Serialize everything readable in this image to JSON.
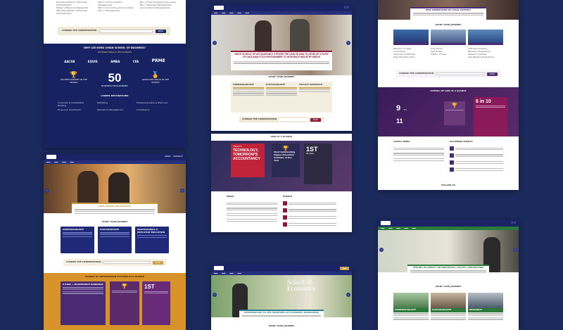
{
  "p1": {
    "links_col1": [
      "Executive Master of Business Administration",
      "Master of Business (Research)",
      "SMU-Ross Master of Business Administration"
    ],
    "links_col2": [
      "MSc in Communication Management",
      "MSc in Accounting and Innovation",
      "MSc in Management"
    ],
    "links_col3": [
      "MSc in Financial Technology (Asia)",
      "MSc in Business Management (Luxury Brand Management)"
    ],
    "cta_label": "CHANGE THE CONVERSATION",
    "cta_button": "SEND",
    "why_title": "WHY LEE KONG CHIAN SCHOOL OF BUSINESS?",
    "accreditation_label": "INTERNATIONALLY RECOGNIZED",
    "logos": [
      "AACSB",
      "EQUIS",
      "AMBA",
      "CFA",
      "PRME"
    ],
    "stat_big": "50",
    "stat_caption": "BUSINESS PROGRAMMES",
    "stat_left": "HIGHEST RANKED IN THE WORLD",
    "stat_right": "GRADUATE SKILLS IN THE WORLD",
    "careers_title": "CAREER DESTINATIONS",
    "careers": [
      "Corporate & Institutional Banking",
      "Finance & Investment",
      "Marketing",
      "Operations Management",
      "Finance",
      "Consultancy",
      "Entrepreneurship & Start-ups"
    ]
  },
  "p2": {
    "hero_title": "SMU'S SCHOOL OF ACCOUNTANCY STRIVES THE LEAD IN ASIA TO DEVELOP A SUITE OF DATA ANALYTICS PROGRAMMES TO INTEGRATE INDUSTRY NEEDS",
    "journey_title": "START YOUR JOURNEY",
    "columns": [
      "UNDERGRADUATE",
      "POSTGRADUATE",
      "FACULTY RESEARCH"
    ],
    "cta_label": "CHANGE THE CONVERSATION",
    "cta_button": "SEND",
    "glance_title": "SMU AT A GLANCE",
    "tech_small": "TODAY'S",
    "tech_big": "TECHNOLOGY, TOMORROW'S ACCOUNTANCY",
    "award_title": "Most Outstanding Higher Education Institute of the Year",
    "first_label": "1ST",
    "first_sub": "IN ASIA",
    "news_title": "NEWS",
    "events_title": "EVENTS"
  },
  "p3": {
    "header_links": [
      "APPLY",
      "CONTACT"
    ],
    "hero_caption": "NEW DEGREE PROGRAMME",
    "journey_title": "START YOUR JOURNEY",
    "cards": [
      "UNDERGRADUATE",
      "POSTGRADUATE",
      "PROFESSIONAL & EXECUTIVE EDUCATION"
    ],
    "cta_label": "CHANGE THE CONVERSATION",
    "cta_button": "SEND",
    "glance_title": "SCHOOL OF INFORMATION SYSTEMS AT A GLANCE",
    "item1": "5 STAR + IN RESEARCH RANKINGS",
    "first_label": "1ST"
  },
  "p4": {
    "school_title_1": "School of",
    "school_title_2": "Economics",
    "hero_caption": "CONTRIBUTING TO THE FRONTIERS OF ECONOMIC KNOWLEDGE",
    "journey_title": "START YOUR JOURNEY"
  },
  "p5": {
    "hero_caption": "NEW GENERATION OF LEGAL EXPERTS",
    "journey_title": "START YOUR JOURNEY",
    "links_col1": [
      "Bachelor of Laws",
      "Juris Doctor",
      "Graduate Certificate",
      "Executive Education"
    ],
    "links_col2": [
      "Juris Doctor",
      "LLM (Laws)",
      "Master of Laws"
    ],
    "links_col3": [
      "LLM Law Academy",
      "Bachelor Programme",
      "Research Centres",
      "Law Masters Programme"
    ],
    "cta_label": "CHANGE THE CONVERSATION",
    "cta_button": "SEND",
    "glance_title": "SCHOOL OF LAW AT A GLANCE",
    "stat1_big": "9",
    "stat1_sup": "TH",
    "stat2_big": "11",
    "stat3_big": "6 in 10",
    "latest_news": "LATEST NEWS",
    "upcoming": "UPCOMING EVENTS",
    "follow": "FOLLOW US"
  },
  "p6": {
    "hero_caption": "MAKING AN IMPACT ON INDIVIDUAL, SOCIETY AND BEYOND",
    "journey_title": "START YOUR JOURNEY",
    "cards": [
      "UNDERGRADUATE",
      "POSTGRADUATE",
      "RESEARCH"
    ]
  },
  "colors": {
    "background": "#1b2a5c",
    "navy": "#151f5a",
    "gold": "#c8a04a",
    "purple": "#4a2a73",
    "magenta": "#8a1a5a",
    "green": "#2b7a3b",
    "teal": "#2a7a8a",
    "orange": "#d8922a"
  }
}
